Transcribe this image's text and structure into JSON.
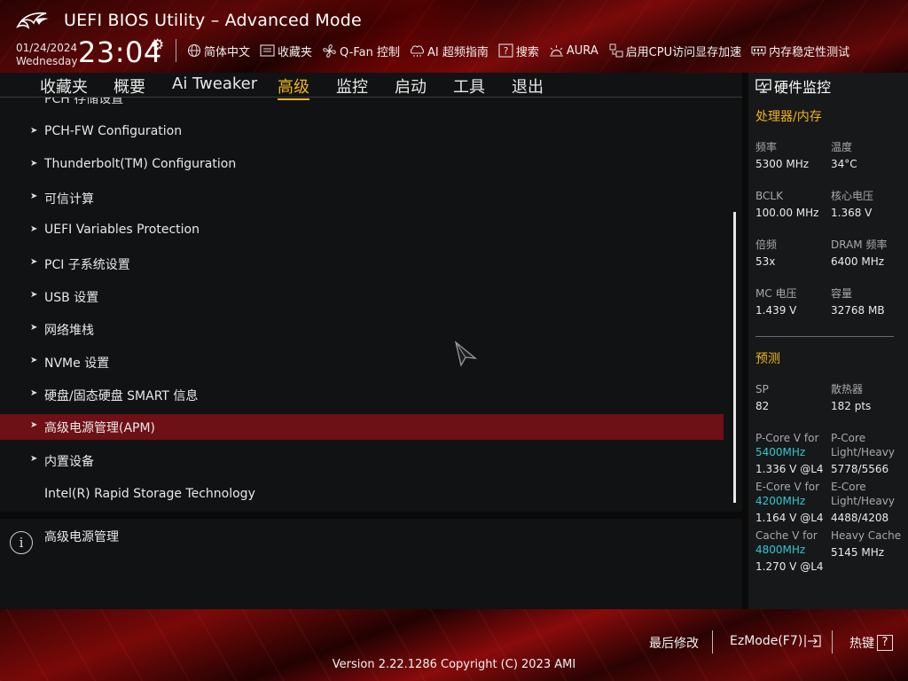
{
  "header": {
    "app_title": "UEFI BIOS Utility – Advanced Mode",
    "date": "01/24/2024",
    "weekday": "Wednesday",
    "time": "23:04",
    "toolbar": [
      {
        "icon": "globe-icon",
        "label": "简体中文"
      },
      {
        "icon": "bookmark-icon",
        "label": "收藏夹"
      },
      {
        "icon": "fan-icon",
        "label": "Q-Fan 控制"
      },
      {
        "icon": "ai-chip-icon",
        "label": "AI 超频指南"
      },
      {
        "icon": "search-icon",
        "label": "搜索"
      },
      {
        "icon": "aura-icon",
        "label": "AURA"
      },
      {
        "icon": "cpu-memory-icon",
        "label": "启用CPU访问显存加速"
      },
      {
        "icon": "memory-test-icon",
        "label": "内存稳定性测试"
      }
    ]
  },
  "tabs": [
    {
      "label": "收藏夹",
      "active": false
    },
    {
      "label": "概要",
      "active": false
    },
    {
      "label": "Ai Tweaker",
      "active": false
    },
    {
      "label": "高级",
      "active": true
    },
    {
      "label": "监控",
      "active": false
    },
    {
      "label": "启动",
      "active": false
    },
    {
      "label": "工具",
      "active": false
    },
    {
      "label": "退出",
      "active": false
    }
  ],
  "menu": {
    "partial_top_item": "PCH 存储设置",
    "items": [
      {
        "label": "PCH-FW Configuration",
        "arrow": true,
        "selected": false
      },
      {
        "label": "Thunderbolt(TM) Configuration",
        "arrow": true,
        "selected": false
      },
      {
        "label": "可信计算",
        "arrow": true,
        "selected": false
      },
      {
        "label": "UEFI Variables Protection",
        "arrow": true,
        "selected": false
      },
      {
        "label": "PCI 子系统设置",
        "arrow": true,
        "selected": false
      },
      {
        "label": "USB 设置",
        "arrow": true,
        "selected": false
      },
      {
        "label": "网络堆栈",
        "arrow": true,
        "selected": false
      },
      {
        "label": "NVMe 设置",
        "arrow": true,
        "selected": false
      },
      {
        "label": "硬盘/固态硬盘 SMART 信息",
        "arrow": true,
        "selected": false
      },
      {
        "label": "高级电源管理(APM)",
        "arrow": true,
        "selected": true
      },
      {
        "label": "内置设备",
        "arrow": true,
        "selected": false
      },
      {
        "label": "Intel(R) Rapid Storage Technology",
        "arrow": false,
        "selected": false
      }
    ]
  },
  "help": {
    "text": "高级电源管理"
  },
  "hardware_monitor": {
    "title": "硬件监控",
    "cpu_memory": {
      "heading": "处理器/内存",
      "freq_label": "频率",
      "freq_value": "5300 MHz",
      "temp_label": "温度",
      "temp_value": "34°C",
      "bclk_label": "BCLK",
      "bclk_value": "100.00 MHz",
      "vcore_label": "核心电压",
      "vcore_value": "1.368 V",
      "ratio_label": "倍频",
      "ratio_value": "53x",
      "dram_label": "DRAM 频率",
      "dram_value": "6400 MHz",
      "mc_label": "MC 电压",
      "mc_value": "1.439 V",
      "capacity_label": "容量",
      "capacity_value": "32768 MB"
    },
    "prediction": {
      "heading": "预测",
      "sp_label": "SP",
      "sp_value": "82",
      "cooler_label": "散热器",
      "cooler_value": "182 pts",
      "pcore_v_label": "P-Core V for",
      "pcore_v_freq": "5400MHz",
      "pcore_v_value": "1.336 V @L4",
      "pcore_lh_label1": "P-Core",
      "pcore_lh_label2": "Light/Heavy",
      "pcore_lh_value": "5778/5566",
      "ecore_v_label": "E-Core V for",
      "ecore_v_freq": "4200MHz",
      "ecore_v_value": "1.164 V @L4",
      "ecore_lh_label1": "E-Core",
      "ecore_lh_label2": "Light/Heavy",
      "ecore_lh_value": "4488/4208",
      "cache_v_label": "Cache V for",
      "cache_v_freq": "4800MHz",
      "cache_v_value": "1.270 V @L4",
      "heavy_cache_label": "Heavy Cache",
      "heavy_cache_value": "5145 MHz"
    }
  },
  "footer": {
    "last_modified": "最后修改",
    "ezmode": "EzMode(F7)",
    "hotkeys": "热键",
    "hotkeys_key": "?",
    "version": "Version 2.22.1286 Copyright (C) 2023 AMI"
  },
  "colors": {
    "accent": "#f0b51c",
    "selected_row": "#6e1016",
    "frequency_highlight": "#2fc8d0"
  }
}
